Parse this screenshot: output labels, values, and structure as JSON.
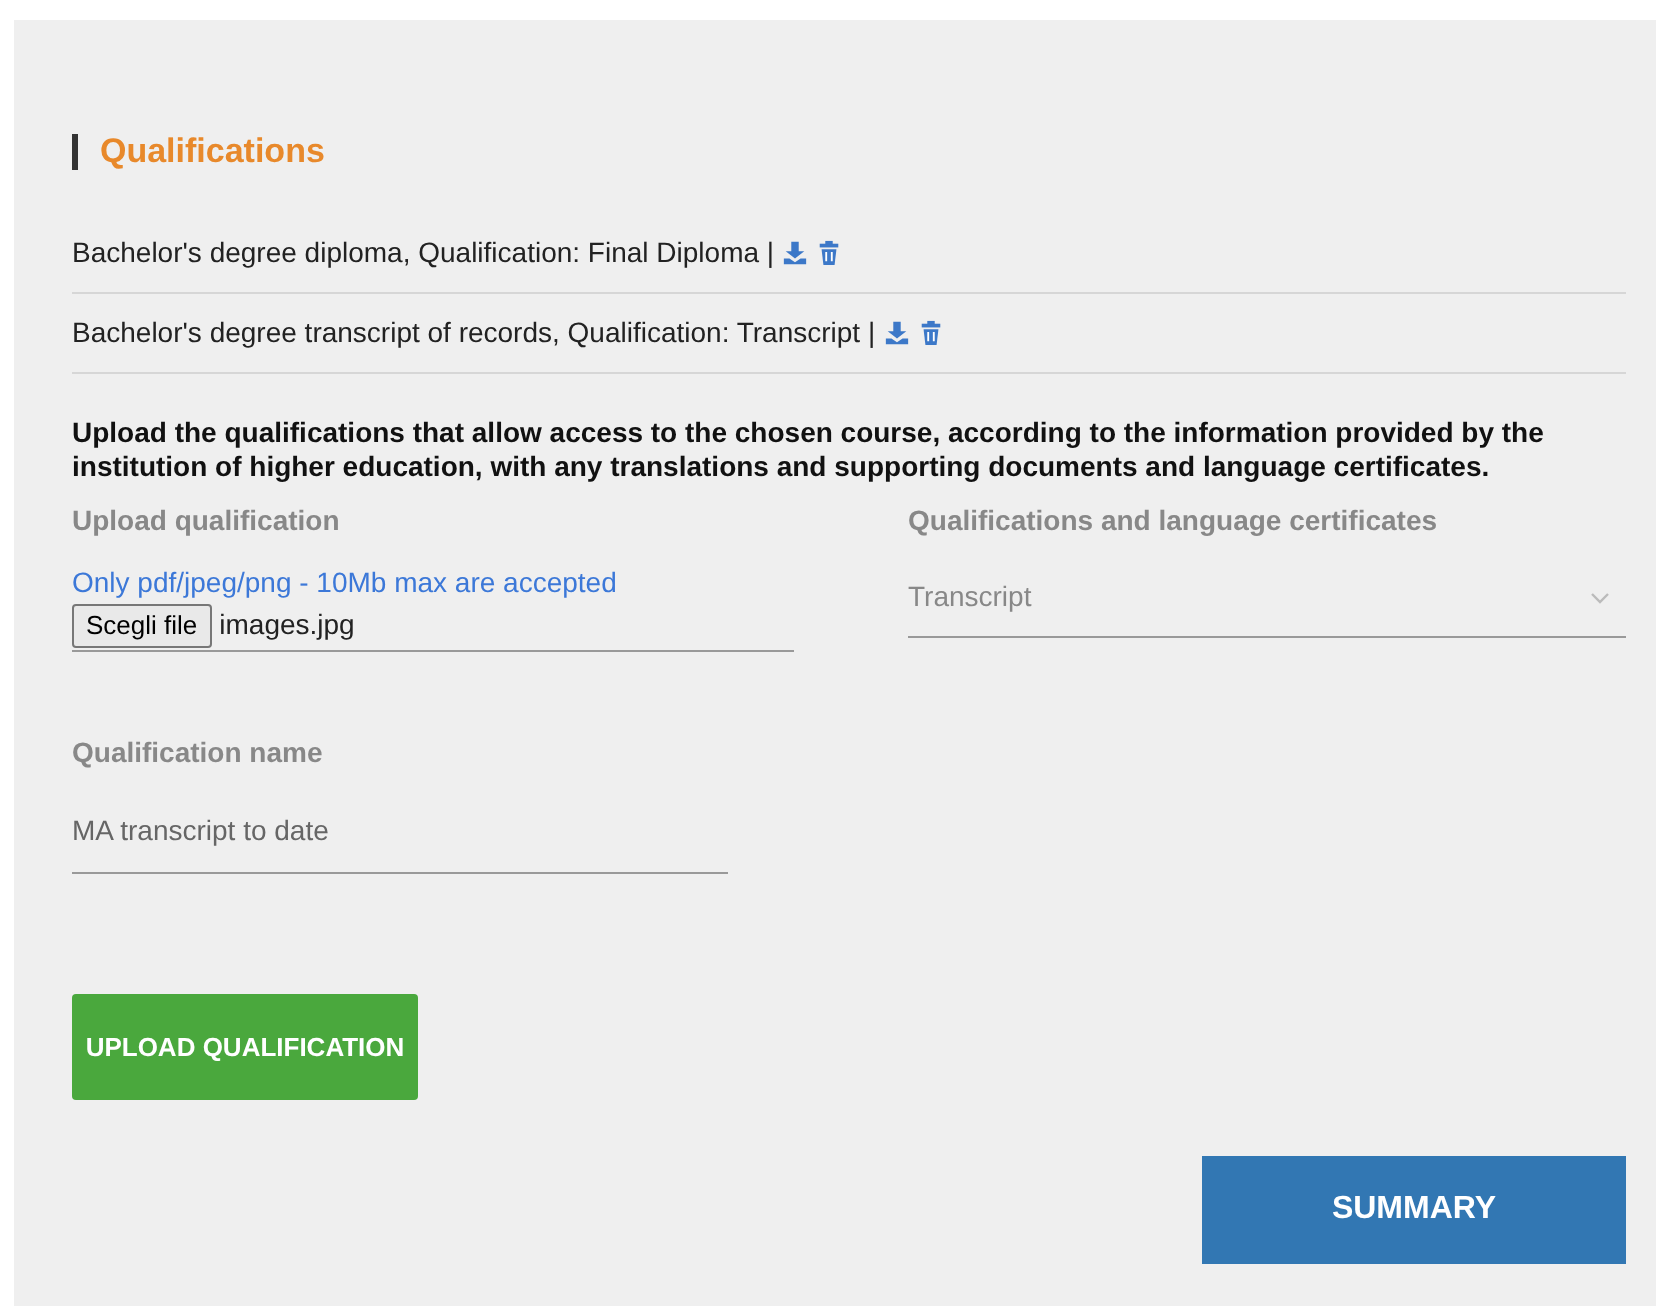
{
  "section_title": "Qualifications",
  "documents": [
    {
      "text": "Bachelor's degree diploma, Qualification: Final Diploma |"
    },
    {
      "text": "Bachelor's degree transcript of records, Qualification: Transcript |"
    }
  ],
  "instructions": "Upload the qualifications that allow access to the chosen course, according to the information provided by the institution of higher education, with any translations and supporting documents and language certificates.",
  "upload": {
    "label": "Upload qualification",
    "hint": "Only pdf/jpeg/png - 10Mb max are accepted",
    "button": "Scegli file",
    "file_name": "images.jpg"
  },
  "certificate_select": {
    "label": "Qualifications and language certificates",
    "value": "Transcript"
  },
  "qualification_name": {
    "label": "Qualification name",
    "value": "MA transcript to date"
  },
  "upload_button": "UPLOAD QUALIFICATION",
  "summary_button": "SUMMARY"
}
